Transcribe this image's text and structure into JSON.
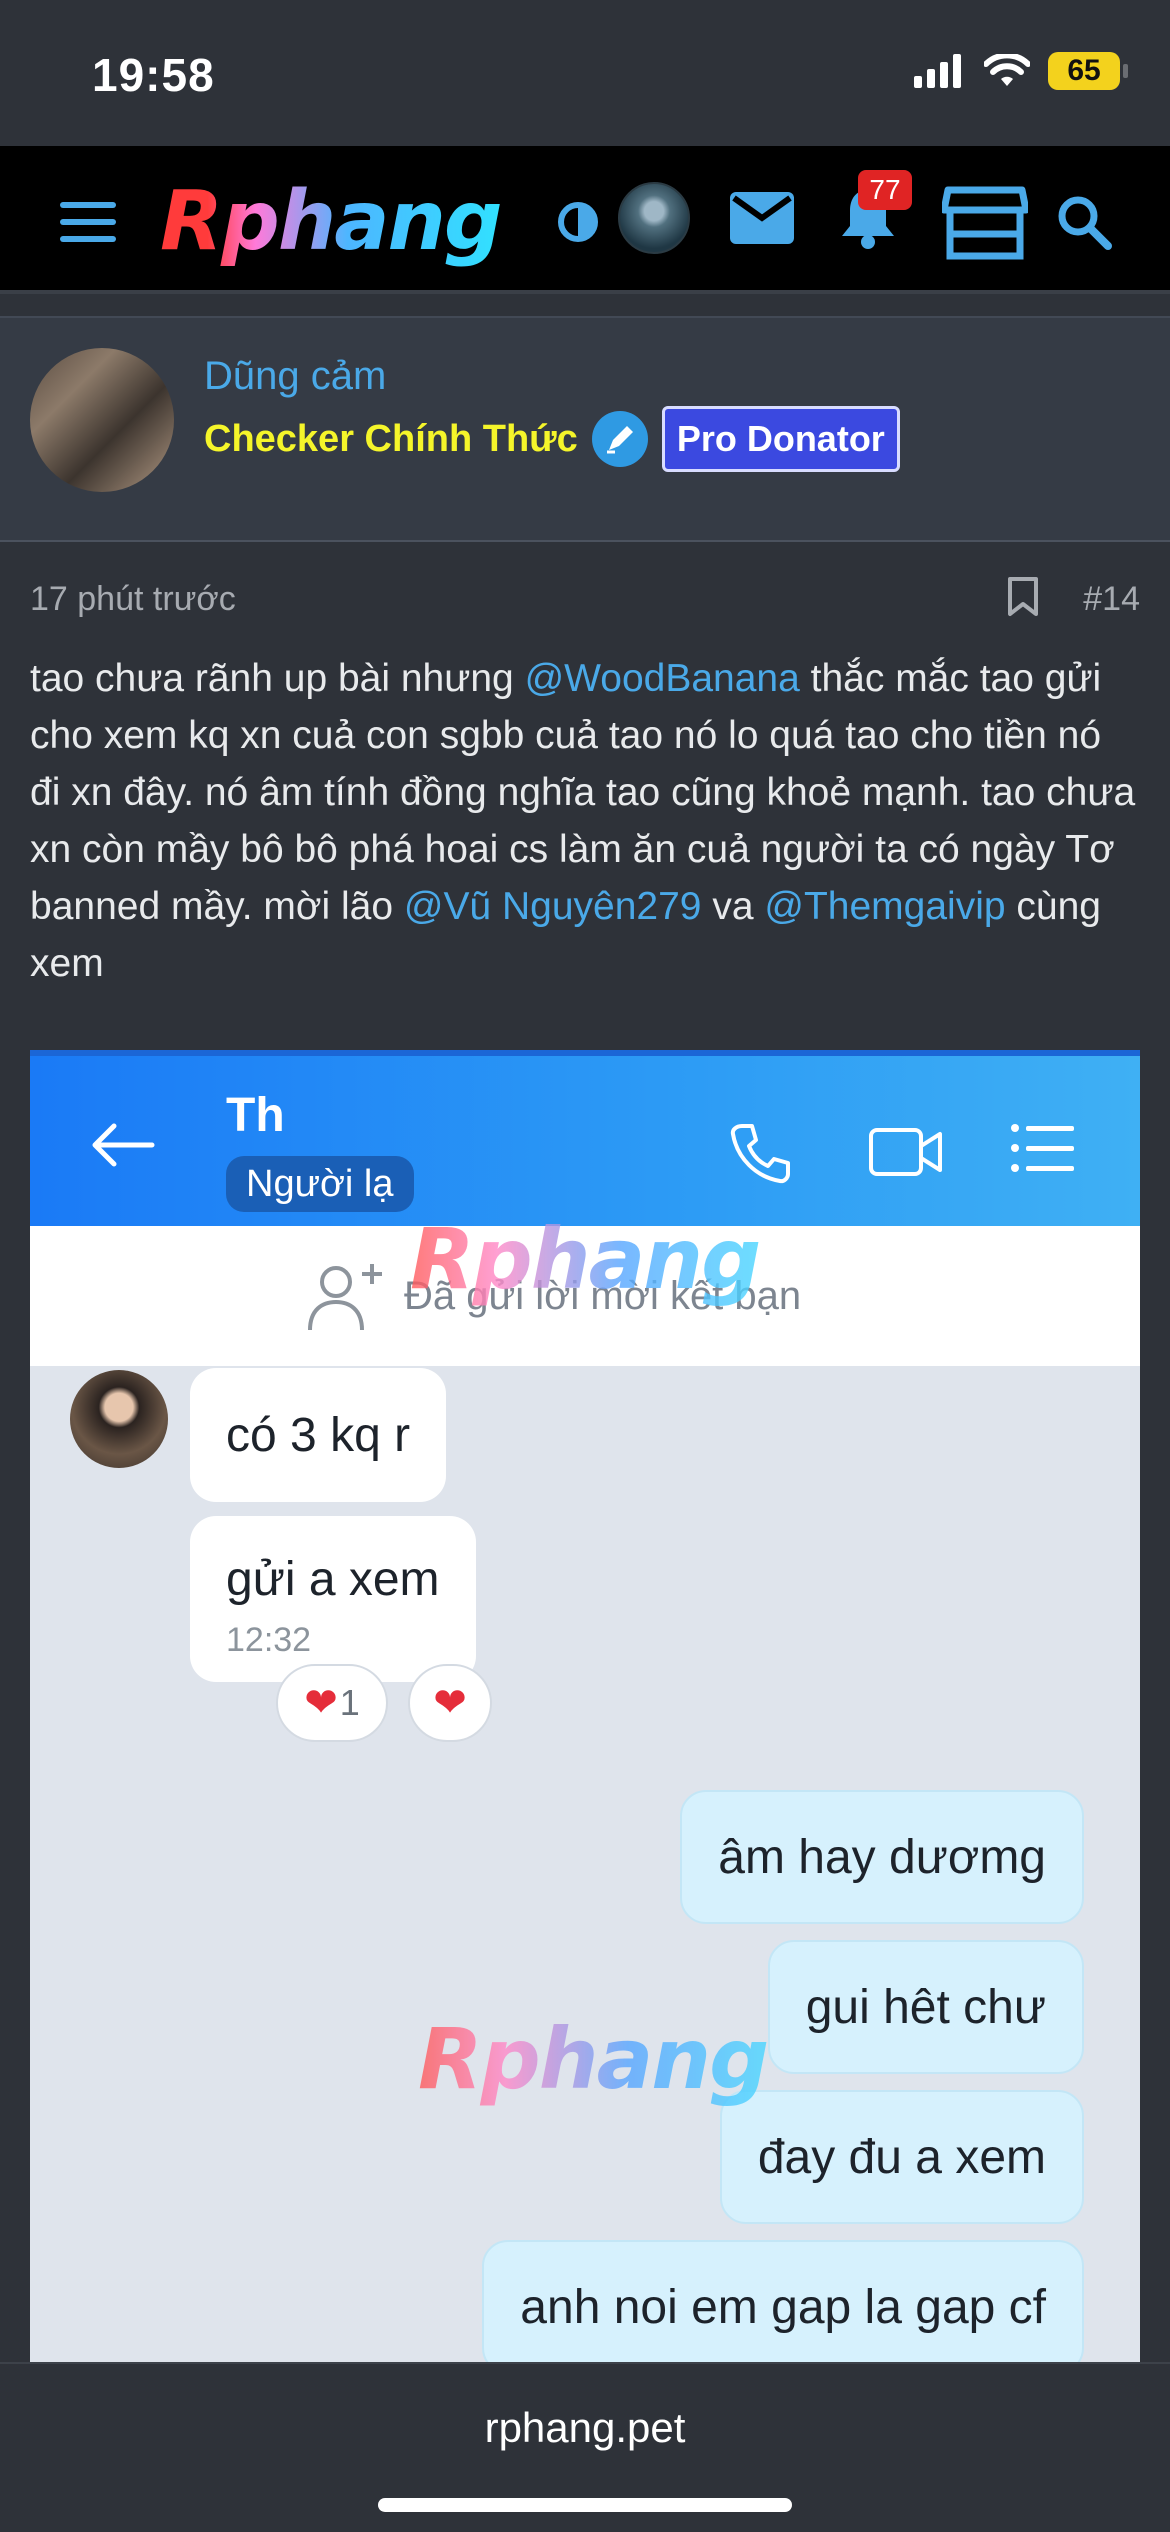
{
  "status_bar": {
    "time": "19:58",
    "battery": "65",
    "icons": [
      "signal-icon",
      "wifi-icon",
      "battery-icon"
    ]
  },
  "header": {
    "logo": "Rphang",
    "notification_count": "77",
    "icons": [
      "menu-icon",
      "theme-toggle-icon",
      "mail-icon",
      "bell-icon",
      "store-icon",
      "search-icon"
    ],
    "accent_color": "#4aa9e8"
  },
  "author": {
    "name": "Dũng cảm",
    "title": "Checker Chính Thức",
    "badge": "Pro Donator"
  },
  "post": {
    "time": "17 phút trước",
    "number": "#14",
    "body": {
      "t1": "tao chưa rãnh up bài nhưng ",
      "m1": "@WoodBanana",
      "t2": " thắc mắc tao gửi cho xem kq xn cuả con sgbb cuả tao nó lo quá tao cho tiền nó đi xn đây. nó âm tính đồng nghĩa tao cũng khoẻ mạnh. tao chưa xn còn mầy bô bô phá hoai cs làm ăn cuả người ta có ngày Tơ banned mầy. mời lão ",
      "m2": "@Vũ Nguyên279",
      "t3": " va ",
      "m3": "@Themgaivip",
      "t4": " cùng xem"
    }
  },
  "attachment": {
    "contact_name": "Th",
    "stranger_label": "Người lạ",
    "friend_request_text": "Đã gửi lời mời kết bạn",
    "watermark": "Rphang",
    "messages": {
      "m1": "có 3 kq r",
      "m2": "gửi a xem",
      "m2_time": "12:32",
      "reaction_count": "1",
      "m3": "âm hay dươmg",
      "m4": "gui hêt chư",
      "m5": "đay đu a xem",
      "m6": "anh noi em gap la gap cf"
    }
  },
  "bottom": {
    "url": "rphang.pet"
  }
}
